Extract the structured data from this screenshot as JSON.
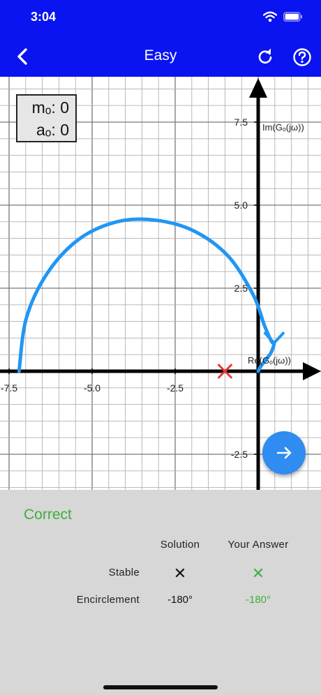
{
  "status_bar": {
    "time": "3:04",
    "icons": [
      "wifi-icon",
      "battery-icon"
    ]
  },
  "app_bar": {
    "title": "Easy",
    "left_icon": "back-chevron-icon",
    "right_icons": [
      "refresh-icon",
      "help-icon"
    ]
  },
  "indicator": {
    "m_label": "mₒ:",
    "m_value": "0",
    "a_label": "aₒ:",
    "a_value": "0"
  },
  "chart_data": {
    "type": "line",
    "xlabel": "Re(Gₒ(jω))",
    "ylabel": "Im(Gₒ(jω))",
    "x_ticks": [
      "-7.5",
      "-5.0",
      "-2.5"
    ],
    "y_ticks": [
      "7.5",
      "5.0",
      "2.5",
      "-2.5"
    ],
    "xlim": [
      -7.7,
      1.9
    ],
    "ylim": [
      -3.5,
      8.7
    ],
    "grid": true,
    "series": [
      {
        "color": "#2196f3",
        "x": [
          -7.2,
          -6.98,
          -6.35,
          -5.39,
          -4.25,
          -3.1,
          -1.93,
          -0.89,
          -0.15,
          0.18,
          0.4,
          0.48,
          0.38,
          0.1,
          0
        ],
        "y": [
          0,
          1.6,
          2.95,
          3.98,
          4.5,
          4.55,
          4.22,
          3.45,
          2.3,
          1.4,
          0.9,
          0.85,
          0.55,
          0.18,
          0
        ]
      }
    ],
    "critical_point": {
      "x": -1,
      "y": 0,
      "marker": "cross",
      "color": "#e53935"
    }
  },
  "fab": {
    "icon": "arrow-right-icon",
    "color": "#2f8cf0"
  },
  "result": {
    "status": "Correct",
    "col_solution": "Solution",
    "col_answer": "Your Answer",
    "rows": [
      {
        "label": "Stable",
        "solution": "✕",
        "answer": "✕"
      },
      {
        "label": "Encirclement",
        "solution": "-180°",
        "answer": "-180°"
      }
    ],
    "answer_color": "#3fae3f",
    "primary_color": "#0a14f0"
  }
}
